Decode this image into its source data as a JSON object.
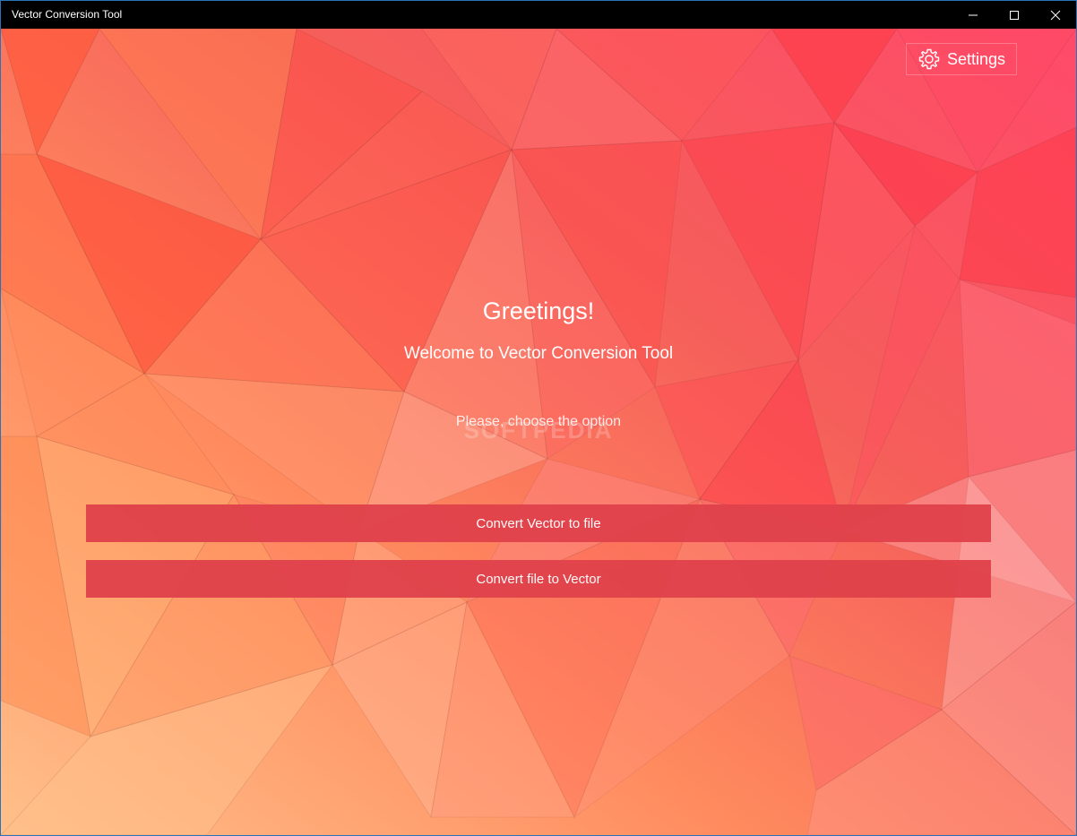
{
  "window": {
    "title": "Vector Conversion Tool",
    "controls": {
      "minimize": "minimize-icon",
      "maximize": "maximize-icon",
      "close": "close-icon"
    }
  },
  "settings": {
    "label": "Settings",
    "icon": "gear-icon"
  },
  "main": {
    "greeting": "Greetings!",
    "welcome": "Welcome to Vector Conversion Tool",
    "prompt": "Please, choose the option",
    "watermark": "SOFTPEDIA",
    "actions": [
      {
        "label": "Convert Vector to file"
      },
      {
        "label": "Convert file to Vector"
      }
    ]
  },
  "colors": {
    "titlebar": "#000000",
    "button": "#e0424b",
    "accent_red": "#f03a48",
    "accent_orange": "#ff7a3d",
    "accent_peach": "#ffc4a0"
  }
}
